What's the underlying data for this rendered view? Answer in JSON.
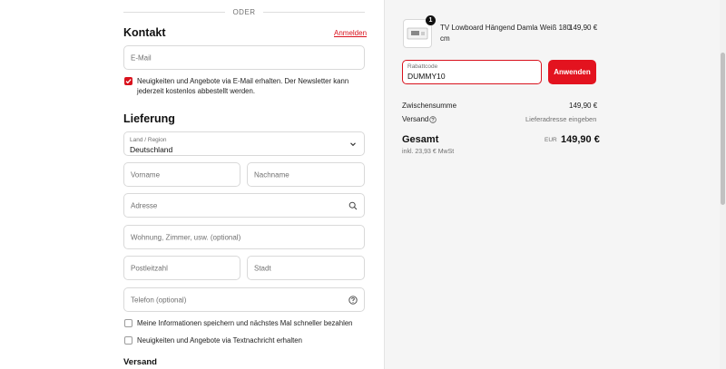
{
  "divider_label": "ODER",
  "contact": {
    "heading": "Kontakt",
    "login_link": "Anmelden",
    "email_placeholder": "E-Mail",
    "newsletter_line1": "Neuigkeiten und Angebote via E-Mail erhalten. Der Newsletter kann",
    "newsletter_line2": "jederzeit kostenlos abbestellt werden.",
    "newsletter_checked": true
  },
  "delivery": {
    "heading": "Lieferung",
    "country_label": "Land / Region",
    "country_value": "Deutschland",
    "first_name_placeholder": "Vorname",
    "last_name_placeholder": "Nachname",
    "address_placeholder": "Adresse",
    "apartment_placeholder": "Wohnung, Zimmer, usw. (optional)",
    "postal_code_placeholder": "Postleitzahl",
    "city_placeholder": "Stadt",
    "phone_placeholder": "Telefon (optional)",
    "save_info_label": "Meine Informationen speichern und nächstes Mal schneller bezahlen",
    "sms_label": "Neuigkeiten und Angebote via Textnachricht erhalten"
  },
  "shipping_heading": "Versand",
  "order_summary": {
    "item_quantity": "1",
    "item_name_line1": "TV Lowboard Hängend Damla Weiß 180",
    "item_name_line2": "cm",
    "item_price": "149,90 €",
    "discount_label": "Rabattcode",
    "discount_value": "DUMMY10",
    "apply_button": "Anwenden",
    "subtotal_label": "Zwischensumme",
    "subtotal_value": "149,90 €",
    "shipping_label": "Versand",
    "shipping_value": "Lieferadresse eingeben",
    "total_label": "Gesamt",
    "currency": "EUR",
    "total_value": "149,90 €",
    "tax_note": "inkl. 23,93 € MwSt"
  },
  "colors": {
    "accent": "#e3131f",
    "summary_bg": "#f5f5f5"
  }
}
